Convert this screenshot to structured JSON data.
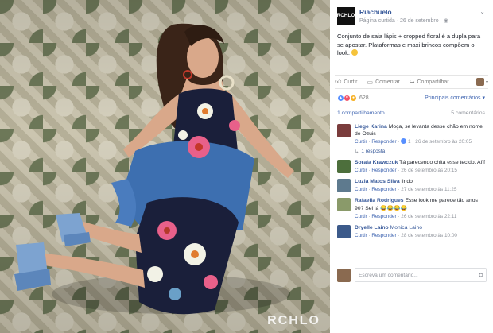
{
  "photo": {
    "watermark": "RCHLO"
  },
  "post": {
    "page_logo_text": "RCHLO",
    "page_name": "Riachuelo",
    "page_meta": "Página curtida · 26 de setembro · ",
    "caption": "Conjunto de saia lápis + cropped floral é a dupla para se apostar. Plataformas e maxi brincos compõem o look. ",
    "actions": {
      "like": "Curtir",
      "comment": "Comentar",
      "share": "Compartilhar"
    },
    "reactions_count": "628",
    "top_comments": "Principais comentários ▾",
    "shares": "1 compartilhamento",
    "comments_count": "5 comentários"
  },
  "comments": [
    {
      "name": "Liege Karina",
      "text": "Moça, se levanta desse chão em nome de Ozuis",
      "meta_like": "Curtir",
      "meta_reply": "Responder",
      "likes": "1",
      "time": "26 de setembro às 20:05",
      "replies_link": "1 resposta",
      "avatar_color": "#7a3c3c"
    },
    {
      "name": "Soraia Krawczuk",
      "text": "Tá parecendo chita esse tecido. Afff",
      "meta_like": "Curtir",
      "meta_reply": "Responder",
      "time": "26 de setembro às 20:15",
      "avatar_color": "#4d6f3c"
    },
    {
      "name": "Luzia Matos Silva",
      "text": "lindo",
      "meta_like": "Curtir",
      "meta_reply": "Responder",
      "time": "27 de setembro às 11:25",
      "avatar_color": "#5e7a8e"
    },
    {
      "name": "Rafaella Rodrigues",
      "text": "Esse look me parece tão anos 90? Sei lá 😂😂😂😂",
      "meta_like": "Curtir",
      "meta_reply": "Responder",
      "time": "26 de setembro às 22:11",
      "avatar_color": "#8a9a6a"
    },
    {
      "name": "Dryelle Laino",
      "text": "Monica Laino",
      "meta_like": "Curtir",
      "meta_reply": "Responder",
      "time": "28 de setembro às 10:00",
      "avatar_color": "#3c5a8a"
    }
  ],
  "write_comment": {
    "placeholder": "Escreva um comentário..."
  }
}
